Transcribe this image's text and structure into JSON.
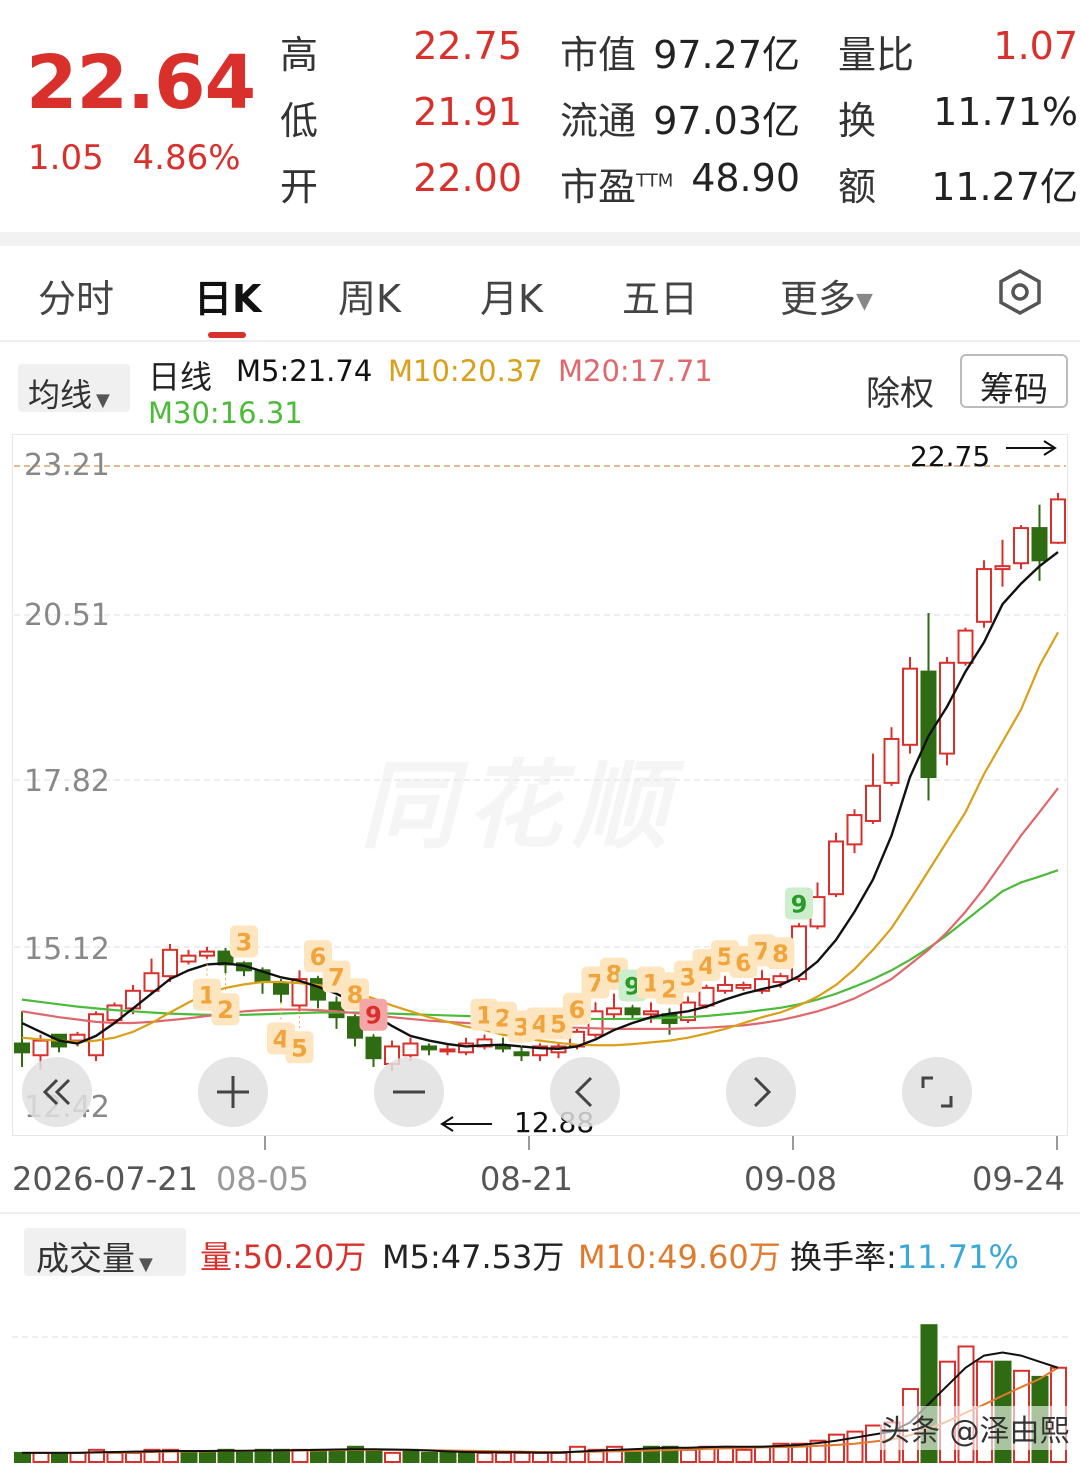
{
  "quote": {
    "price": "22.64",
    "change": "1.05",
    "change_pct": "4.86%",
    "stats": [
      {
        "label": "高",
        "value": "22.75"
      },
      {
        "label": "低",
        "value": "21.91"
      },
      {
        "label": "开",
        "value": "22.00"
      },
      {
        "label": "市值",
        "value": "97.27亿"
      },
      {
        "label": "流通",
        "value": "97.03亿"
      },
      {
        "label": "市盈",
        "sup": "TTM",
        "value": "48.90"
      },
      {
        "label": "量比",
        "value": "1.07"
      },
      {
        "label": "换",
        "value": "11.71%"
      },
      {
        "label": "额",
        "value": "11.27亿"
      }
    ]
  },
  "tabs": [
    {
      "label": "分时"
    },
    {
      "label": "日K"
    },
    {
      "label": "周K"
    },
    {
      "label": "月K"
    },
    {
      "label": "五日"
    },
    {
      "label": "更多"
    }
  ],
  "legend": {
    "ma_button": "均线",
    "period": "日线",
    "m5": "M5:21.74",
    "m10": "M10:20.37",
    "m20": "M20:17.71",
    "m30": "M30:16.31",
    "fq": "除权",
    "chips": "筹码"
  },
  "chart": {
    "y_labels": [
      "23.21",
      "20.51",
      "17.82",
      "15.12",
      "12.42"
    ],
    "high_mark": "22.75",
    "low_mark": "12.88",
    "dates": [
      "2026-07-21",
      "08-05",
      "08-21",
      "09-08",
      "09-24"
    ],
    "watermark": "同花顺"
  },
  "volume": {
    "button": "成交量",
    "vol": "量:50.20万",
    "m5": "M5:47.53万",
    "m10": "M10:49.60万",
    "turnover_label": "换手率:",
    "turnover": "11.71%"
  },
  "brand": "头条 @泽由熙",
  "colors": {
    "up": "#d9302c",
    "down": "#2e6b12",
    "m5": "#111111",
    "m10": "#d9a018",
    "m20": "#e0686c",
    "m30": "#4cbb3a",
    "count": "#f2a43c",
    "count_bg": "#fde6bf",
    "nine_green": "#2a9a2a",
    "turnover": "#3aa8d8"
  },
  "chart_data": {
    "type": "candlestick",
    "candles": [
      {
        "o": 13.35,
        "c": 13.2,
        "h": 13.9,
        "l": 12.95
      },
      {
        "o": 13.15,
        "c": 13.4,
        "h": 13.5,
        "l": 12.9
      },
      {
        "o": 13.5,
        "c": 13.3,
        "h": 13.5,
        "l": 13.2
      },
      {
        "o": 13.4,
        "c": 13.5,
        "h": 13.55,
        "l": 13.3
      },
      {
        "o": 13.15,
        "c": 13.85,
        "h": 13.9,
        "l": 13.05
      },
      {
        "o": 13.75,
        "c": 14.0,
        "h": 14.05,
        "l": 13.7
      },
      {
        "o": 13.95,
        "c": 14.25,
        "h": 14.35,
        "l": 13.85
      },
      {
        "o": 14.25,
        "c": 14.55,
        "h": 14.8,
        "l": 14.2
      },
      {
        "o": 14.5,
        "c": 14.95,
        "h": 15.05,
        "l": 14.4
      },
      {
        "o": 14.75,
        "c": 14.85,
        "h": 14.95,
        "l": 14.7
      },
      {
        "o": 14.85,
        "c": 14.92,
        "h": 15.0,
        "l": 14.8
      },
      {
        "o": 14.92,
        "c": 14.7,
        "h": 14.98,
        "l": 14.55
      },
      {
        "o": 14.72,
        "c": 14.6,
        "h": 14.75,
        "l": 14.5
      },
      {
        "o": 14.6,
        "c": 14.4,
        "h": 14.65,
        "l": 14.2
      },
      {
        "o": 14.38,
        "c": 14.2,
        "h": 14.45,
        "l": 14.05
      },
      {
        "o": 14.0,
        "c": 14.45,
        "h": 14.6,
        "l": 13.9
      },
      {
        "o": 14.45,
        "c": 14.1,
        "h": 14.5,
        "l": 13.95
      },
      {
        "o": 14.05,
        "c": 13.8,
        "h": 14.15,
        "l": 13.6
      },
      {
        "o": 13.8,
        "c": 13.45,
        "h": 13.85,
        "l": 13.3
      },
      {
        "o": 13.45,
        "c": 13.1,
        "h": 13.5,
        "l": 12.95
      },
      {
        "o": 13.0,
        "c": 13.3,
        "h": 13.4,
        "l": 12.88
      },
      {
        "o": 13.15,
        "c": 13.35,
        "h": 13.45,
        "l": 13.05
      },
      {
        "o": 13.3,
        "c": 13.25,
        "h": 13.35,
        "l": 13.15
      },
      {
        "o": 13.25,
        "c": 13.25,
        "h": 13.35,
        "l": 13.15
      },
      {
        "o": 13.2,
        "c": 13.35,
        "h": 13.45,
        "l": 13.15
      },
      {
        "o": 13.3,
        "c": 13.42,
        "h": 13.5,
        "l": 13.25
      },
      {
        "o": 13.3,
        "c": 13.28,
        "h": 13.45,
        "l": 13.2
      },
      {
        "o": 13.2,
        "c": 13.15,
        "h": 13.3,
        "l": 13.05
      },
      {
        "o": 13.15,
        "c": 13.3,
        "h": 13.35,
        "l": 13.05
      },
      {
        "o": 13.2,
        "c": 13.3,
        "h": 13.35,
        "l": 13.1
      },
      {
        "o": 13.3,
        "c": 13.55,
        "h": 13.6,
        "l": 13.25
      },
      {
        "o": 13.5,
        "c": 13.9,
        "h": 14.05,
        "l": 13.45
      },
      {
        "o": 13.85,
        "c": 13.95,
        "h": 14.2,
        "l": 13.75
      },
      {
        "o": 13.95,
        "c": 13.85,
        "h": 14.0,
        "l": 13.75
      },
      {
        "o": 13.85,
        "c": 13.9,
        "h": 14.05,
        "l": 13.7
      },
      {
        "o": 13.85,
        "c": 13.7,
        "h": 13.95,
        "l": 13.5
      },
      {
        "o": 13.75,
        "c": 14.05,
        "h": 14.15,
        "l": 13.7
      },
      {
        "o": 14.0,
        "c": 14.3,
        "h": 14.35,
        "l": 13.95
      },
      {
        "o": 14.25,
        "c": 14.35,
        "h": 14.5,
        "l": 14.2
      },
      {
        "o": 14.3,
        "c": 14.35,
        "h": 14.4,
        "l": 14.25
      },
      {
        "o": 14.25,
        "c": 14.45,
        "h": 14.6,
        "l": 14.2
      },
      {
        "o": 14.4,
        "c": 14.5,
        "h": 14.55,
        "l": 14.3
      },
      {
        "o": 14.45,
        "c": 15.35,
        "h": 15.4,
        "l": 14.4
      },
      {
        "o": 15.35,
        "c": 15.85,
        "h": 16.1,
        "l": 15.3
      },
      {
        "o": 15.9,
        "c": 16.8,
        "h": 16.95,
        "l": 15.85
      },
      {
        "o": 16.75,
        "c": 17.25,
        "h": 17.35,
        "l": 16.6
      },
      {
        "o": 17.15,
        "c": 17.75,
        "h": 18.3,
        "l": 17.1
      },
      {
        "o": 17.8,
        "c": 18.55,
        "h": 18.75,
        "l": 17.75
      },
      {
        "o": 18.45,
        "c": 19.75,
        "h": 19.95,
        "l": 18.3
      },
      {
        "o": 19.7,
        "c": 17.9,
        "h": 20.7,
        "l": 17.5
      },
      {
        "o": 18.3,
        "c": 19.85,
        "h": 19.95,
        "l": 18.1
      },
      {
        "o": 19.85,
        "c": 20.4,
        "h": 20.45,
        "l": 19.8
      },
      {
        "o": 20.55,
        "c": 21.45,
        "h": 21.6,
        "l": 20.45
      },
      {
        "o": 21.45,
        "c": 21.5,
        "h": 21.95,
        "l": 21.15
      },
      {
        "o": 21.55,
        "c": 22.15,
        "h": 22.2,
        "l": 21.45
      },
      {
        "o": 22.15,
        "c": 21.6,
        "h": 22.55,
        "l": 21.25
      },
      {
        "o": 21.9,
        "c": 22.64,
        "h": 22.75,
        "l": 21.88
      }
    ],
    "ma5": [
      13.7,
      13.55,
      13.4,
      13.35,
      13.48,
      13.7,
      13.95,
      14.2,
      14.45,
      14.6,
      14.7,
      14.72,
      14.68,
      14.58,
      14.48,
      14.42,
      14.32,
      14.2,
      14.05,
      13.85,
      13.65,
      13.48,
      13.4,
      13.34,
      13.3,
      13.32,
      13.33,
      13.3,
      13.27,
      13.26,
      13.3,
      13.42,
      13.58,
      13.7,
      13.8,
      13.86,
      13.9,
      13.98,
      14.1,
      14.2,
      14.28,
      14.35,
      14.5,
      14.75,
      15.12,
      15.6,
      16.15,
      16.9,
      17.9,
      18.6,
      19.1,
      19.7,
      20.2,
      20.85,
      21.2,
      21.5,
      21.74
    ],
    "ma10": [
      13.45,
      13.42,
      13.4,
      13.38,
      13.4,
      13.45,
      13.55,
      13.7,
      13.88,
      14.05,
      14.2,
      14.3,
      14.36,
      14.4,
      14.4,
      14.38,
      14.35,
      14.3,
      14.22,
      14.12,
      14.0,
      13.9,
      13.8,
      13.72,
      13.64,
      13.58,
      13.5,
      13.45,
      13.4,
      13.36,
      13.33,
      13.32,
      13.32,
      13.34,
      13.37,
      13.4,
      13.45,
      13.52,
      13.6,
      13.7,
      13.8,
      13.88,
      14.0,
      14.15,
      14.35,
      14.62,
      14.95,
      15.32,
      15.8,
      16.3,
      16.8,
      17.3,
      17.95,
      18.5,
      19.05,
      19.8,
      20.37
    ],
    "ma20": [
      13.9,
      13.85,
      13.8,
      13.76,
      13.72,
      13.7,
      13.7,
      13.72,
      13.75,
      13.78,
      13.82,
      13.86,
      13.9,
      13.92,
      13.93,
      13.93,
      13.92,
      13.9,
      13.87,
      13.84,
      13.8,
      13.77,
      13.74,
      13.72,
      13.7,
      13.68,
      13.66,
      13.65,
      13.64,
      13.63,
      13.62,
      13.61,
      13.6,
      13.6,
      13.6,
      13.6,
      13.61,
      13.62,
      13.64,
      13.66,
      13.7,
      13.75,
      13.82,
      13.9,
      14.0,
      14.12,
      14.28,
      14.45,
      14.7,
      14.95,
      15.25,
      15.6,
      16.0,
      16.45,
      16.9,
      17.3,
      17.71
    ],
    "ma30": [
      14.1,
      14.06,
      14.02,
      13.98,
      13.95,
      13.92,
      13.9,
      13.88,
      13.86,
      13.85,
      13.84,
      13.84,
      13.84,
      13.85,
      13.86,
      13.87,
      13.88,
      13.88,
      13.88,
      13.87,
      13.86,
      13.85,
      13.84,
      13.83,
      13.82,
      13.81,
      13.8,
      13.79,
      13.78,
      13.78,
      13.77,
      13.77,
      13.77,
      13.77,
      13.78,
      13.79,
      13.8,
      13.82,
      13.85,
      13.88,
      13.92,
      13.96,
      14.02,
      14.1,
      14.2,
      14.32,
      14.45,
      14.6,
      14.78,
      14.98,
      15.2,
      15.45,
      15.7,
      15.95,
      16.1,
      16.2,
      16.31
    ],
    "counts": [
      {
        "i": 10,
        "n": "1",
        "pos": "below"
      },
      {
        "i": 11,
        "n": "2",
        "pos": "below"
      },
      {
        "i": 12,
        "n": "3",
        "pos": "above"
      },
      {
        "i": 14,
        "n": "4",
        "pos": "below"
      },
      {
        "i": 15,
        "n": "5",
        "pos": "below"
      },
      {
        "i": 16,
        "n": "6",
        "pos": "above"
      },
      {
        "i": 17,
        "n": "7",
        "pos": "above"
      },
      {
        "i": 18,
        "n": "8",
        "pos": "above"
      },
      {
        "i": 19,
        "n": "9",
        "pos": "above",
        "red": true
      },
      {
        "i": 25,
        "n": "1",
        "pos": "above"
      },
      {
        "i": 26,
        "n": "2",
        "pos": "above"
      },
      {
        "i": 27,
        "n": "3",
        "pos": "above"
      },
      {
        "i": 28,
        "n": "4",
        "pos": "above"
      },
      {
        "i": 29,
        "n": "5",
        "pos": "above"
      },
      {
        "i": 30,
        "n": "6",
        "pos": "above"
      },
      {
        "i": 31,
        "n": "7",
        "pos": "above"
      },
      {
        "i": 32,
        "n": "8",
        "pos": "above"
      },
      {
        "i": 33,
        "n": "9",
        "pos": "above",
        "green": true
      },
      {
        "i": 34,
        "n": "1",
        "pos": "above"
      },
      {
        "i": 35,
        "n": "2",
        "pos": "above"
      },
      {
        "i": 36,
        "n": "3",
        "pos": "above"
      },
      {
        "i": 37,
        "n": "4",
        "pos": "above"
      },
      {
        "i": 38,
        "n": "5",
        "pos": "above"
      },
      {
        "i": 39,
        "n": "6",
        "pos": "above"
      },
      {
        "i": 40,
        "n": "7",
        "pos": "above"
      },
      {
        "i": 41,
        "n": "8",
        "pos": "above"
      },
      {
        "i": 42,
        "n": "9",
        "pos": "above",
        "green": true
      }
    ],
    "volumes": [
      3,
      3,
      3,
      3,
      4,
      3,
      3,
      4,
      4,
      3,
      3,
      4,
      3,
      4,
      4,
      4,
      4,
      4,
      5,
      4,
      3,
      4,
      3,
      3,
      3,
      3,
      3,
      3,
      3,
      3,
      5,
      4,
      5,
      4,
      5,
      5,
      4,
      5,
      5,
      4,
      5,
      6,
      6,
      7,
      9,
      10,
      12,
      13,
      24,
      45,
      33,
      38,
      33,
      33,
      30,
      28,
      31
    ],
    "vol_dir": [
      "d",
      "u",
      "d",
      "u",
      "u",
      "u",
      "u",
      "u",
      "u",
      "d",
      "d",
      "d",
      "d",
      "d",
      "d",
      "u",
      "d",
      "d",
      "d",
      "d",
      "u",
      "d",
      "d",
      "d",
      "d",
      "u",
      "u",
      "u",
      "u",
      "u",
      "u",
      "u",
      "u",
      "d",
      "d",
      "d",
      "u",
      "u",
      "u",
      "u",
      "u",
      "u",
      "u",
      "u",
      "u",
      "u",
      "u",
      "u",
      "u",
      "d",
      "u",
      "u",
      "u",
      "d",
      "u",
      "d",
      "u"
    ],
    "vol_m5": [
      3,
      3,
      3,
      3,
      3.2,
      3.3,
      3.4,
      3.5,
      3.6,
      3.6,
      3.6,
      3.7,
      3.7,
      3.8,
      3.8,
      3.9,
      4,
      4.1,
      4.2,
      4.2,
      4.1,
      4,
      3.8,
      3.5,
      3.3,
      3.2,
      3.2,
      3.2,
      3.1,
      3.1,
      3.4,
      3.7,
      4,
      4.2,
      4.5,
      4.7,
      4.7,
      4.9,
      5,
      5,
      5,
      5.3,
      5.6,
      6.2,
      7,
      8,
      9,
      10,
      13,
      19,
      25,
      31,
      35,
      36,
      35,
      33,
      31
    ],
    "vol_m10": [
      3,
      3,
      3,
      3,
      3.1,
      3.1,
      3.2,
      3.3,
      3.4,
      3.5,
      3.5,
      3.6,
      3.6,
      3.7,
      3.7,
      3.8,
      3.8,
      3.9,
      4,
      4,
      4,
      4,
      3.9,
      3.8,
      3.7,
      3.6,
      3.5,
      3.4,
      3.3,
      3.3,
      3.3,
      3.4,
      3.5,
      3.6,
      3.8,
      3.9,
      4.1,
      4.3,
      4.5,
      4.6,
      4.8,
      4.9,
      5,
      5.3,
      5.6,
      6,
      6.7,
      7.4,
      8.8,
      11,
      13.3,
      16.2,
      18.9,
      21.8,
      24.6,
      27.3,
      31
    ]
  }
}
